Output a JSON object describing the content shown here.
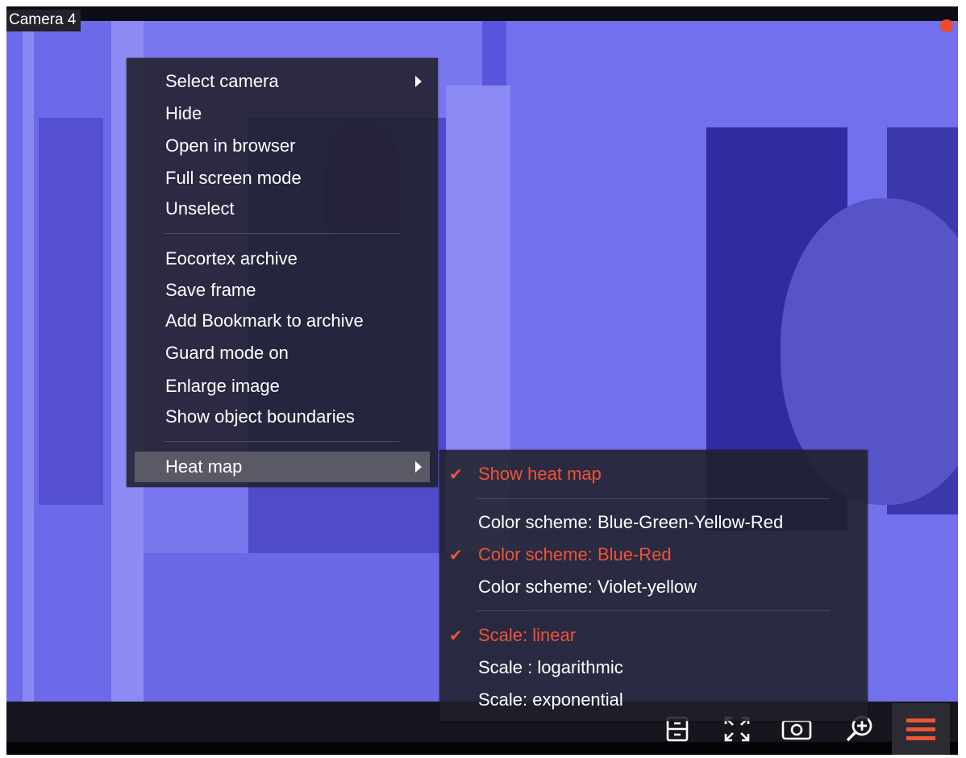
{
  "camera": {
    "label": "Camera 4"
  },
  "colors": {
    "accent": "#ee5437",
    "menu_bg": "#20202a",
    "video_tint": "#5a55de",
    "recording_dot": "#ef4a2d"
  },
  "context_menu": {
    "items": [
      {
        "label": "Select camera",
        "has_submenu": true
      },
      {
        "label": "Hide"
      },
      {
        "label": "Open in browser"
      },
      {
        "label": "Full screen mode"
      },
      {
        "label": "Unselect"
      },
      {
        "label": "Eocortex archive"
      },
      {
        "label": "Save frame"
      },
      {
        "label": "Add Bookmark to archive"
      },
      {
        "label": "Guard mode on"
      },
      {
        "label": "Enlarge image"
      },
      {
        "label": "Show object boundaries"
      },
      {
        "label": "Heat map",
        "has_submenu": true,
        "highlighted": true
      }
    ]
  },
  "heatmap_submenu": {
    "items": [
      {
        "label": "Show heat map",
        "checked": true
      },
      {
        "label": "Color scheme: Blue-Green-Yellow-Red",
        "checked": false
      },
      {
        "label": "Color scheme: Blue-Red",
        "checked": true
      },
      {
        "label": "Color scheme: Violet-yellow",
        "checked": false
      },
      {
        "label": "Scale: linear",
        "checked": true
      },
      {
        "label": "Scale : logarithmic",
        "checked": false
      },
      {
        "label": "Scale: exponential",
        "checked": false
      }
    ]
  },
  "toolbar": {
    "icons": [
      "archive-icon",
      "fullscreen-icon",
      "snapshot-icon",
      "zoom-in-icon",
      "menu-icon"
    ]
  }
}
